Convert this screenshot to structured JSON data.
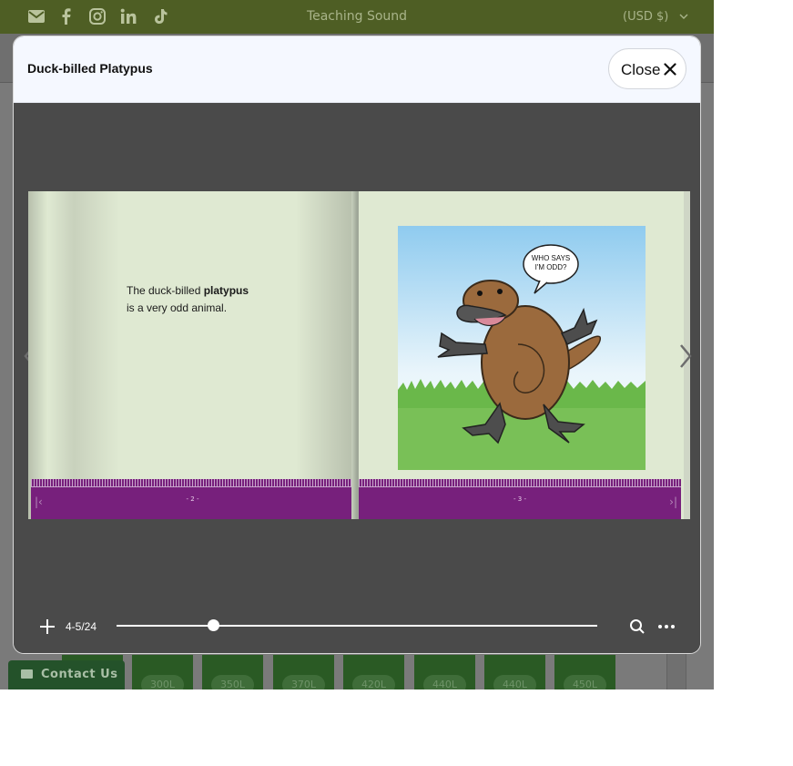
{
  "topbar": {
    "brand": "Teaching Sound",
    "currency": "(USD $)",
    "social_icons": [
      "email-icon",
      "facebook-icon",
      "instagram-icon",
      "linkedin-icon",
      "tiktok-icon"
    ]
  },
  "level_tiles": [
    "300L",
    "350L",
    "370L",
    "420L",
    "440L",
    "440L",
    "450L"
  ],
  "contact": {
    "label": "Contact Us"
  },
  "modal": {
    "title": "Duck-billed Platypus",
    "close_label": "Close"
  },
  "book": {
    "left_page": {
      "text_before": "The duck-billed ",
      "text_bold": "platypus",
      "text_after": "is a very odd animal.",
      "page_number": "- 2 -"
    },
    "right_page": {
      "speech_line1": "WHO SAYS",
      "speech_line2": "I'M ODD?",
      "page_number": "- 3 -"
    }
  },
  "toolbar": {
    "pages_label": "4-5/24",
    "current_page": 4,
    "total_pages": 24,
    "progress": 0.2
  },
  "colors": {
    "topbar": "#4e5e24",
    "book_footer": "#77207c",
    "page_bg": "#dfe9d2",
    "viewer_bg": "#4a4a4a"
  }
}
